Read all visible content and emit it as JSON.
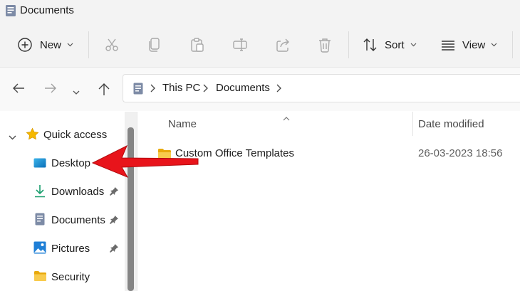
{
  "window": {
    "title": "Documents"
  },
  "toolbar": {
    "new_label": "New",
    "sort_label": "Sort",
    "view_label": "View",
    "icons": [
      "plus-circle-icon",
      "scissors-icon",
      "copy-icon",
      "paste-icon",
      "rename-icon",
      "share-icon",
      "trash-icon",
      "sort-icon",
      "view-icon"
    ]
  },
  "address": {
    "crumbs": [
      "This PC",
      "Documents"
    ]
  },
  "nav": {
    "quick_access": "Quick access",
    "items": [
      {
        "label": "Desktop",
        "icon": "desktop-icon",
        "pinned": false
      },
      {
        "label": "Downloads",
        "icon": "download-icon",
        "pinned": true
      },
      {
        "label": "Documents",
        "icon": "document-icon",
        "pinned": true
      },
      {
        "label": "Pictures",
        "icon": "pictures-icon",
        "pinned": true
      },
      {
        "label": "Security",
        "icon": "folder-icon",
        "pinned": false
      }
    ]
  },
  "content": {
    "columns": {
      "name": "Name",
      "date_modified": "Date modified"
    },
    "rows": [
      {
        "name": "Custom Office Templates",
        "date_modified": "26-03-2023 18:56"
      }
    ]
  },
  "colors": {
    "accent": "#0067c0",
    "folder": "#f4c542",
    "annotation": "#e8141b"
  }
}
